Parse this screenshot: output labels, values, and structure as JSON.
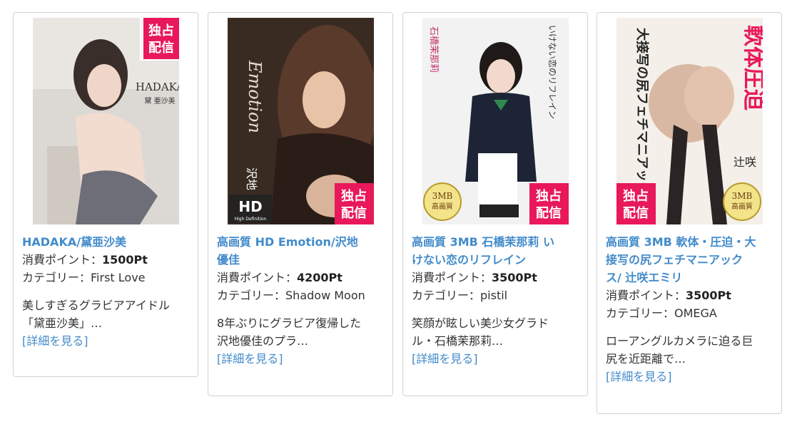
{
  "products": [
    {
      "title": "HADAKA/黛亜沙美",
      "points_label": "消費ポイント：",
      "points": "1500Pt",
      "category_label": "カテゴリー：",
      "category": "First Love",
      "desc_line1": "美しすぎるグラビアアイドル",
      "desc_line2": "「黛亜沙美」…",
      "more": "[詳細を見る]",
      "cover_title": "HADAKA",
      "cover_sub": "黛 亜沙美",
      "badge": [
        "独占",
        "配信"
      ],
      "accent": "#e8185a"
    },
    {
      "title_line1": "高画質 HD Emotion/沢地",
      "title_line2": "優佳",
      "points_label": "消費ポイント：",
      "points": "4200Pt",
      "category_label": "カテゴリー：",
      "category": "Shadow Moon",
      "desc_line1": "8年ぶりにグラビア復帰した",
      "desc_line2": "沢地優佳のプラ…",
      "more": "[詳細を見る]",
      "cover_title": "Emotion",
      "cover_hd": "HD",
      "cover_hd_sub": "High Definition",
      "cover_name": "沢地",
      "badge": [
        "独占",
        "配信"
      ],
      "accent": "#e8185a"
    },
    {
      "title_line1": "高画質 3MB 石橋茉那莉 い",
      "title_line2": "けない恋のリフレイン",
      "points_label": "消費ポイント：",
      "points": "3500Pt",
      "category_label": "カテゴリー：",
      "category": "pistil",
      "desc_line1": "笑顔が眩しい美少女グラド",
      "desc_line2": "ル・石橋茉那莉…",
      "more": "[詳細を見る]",
      "cover_name": "石橋茉那莉",
      "cover_title": "いけない恋のリフレイン",
      "cover_3mb": "3MB",
      "cover_3mb_sub": "高画質",
      "badge": [
        "独占",
        "配信"
      ],
      "accent": "#e8185a"
    },
    {
      "title_line1": "高画質 3MB 軟体・圧迫・大",
      "title_line2": "接写の尻フェチマニアック",
      "title_line3": "ス/ 辻咲エミリ",
      "points_label": "消費ポイント：",
      "points": "3500Pt",
      "category_label": "カテゴリー：",
      "category": "OMEGA",
      "desc_line1": "ローアングルカメラに迫る巨",
      "desc_line2": "尻を近距離で…",
      "more": "[詳細を見る]",
      "cover_title": "大接写の尻フェチマニアックス",
      "cover_big": "軟体圧迫",
      "cover_name": "辻咲",
      "cover_3mb": "3MB",
      "cover_3mb_sub": "高画質",
      "badge": [
        "独占",
        "配信"
      ],
      "accent": "#e8185a"
    }
  ]
}
